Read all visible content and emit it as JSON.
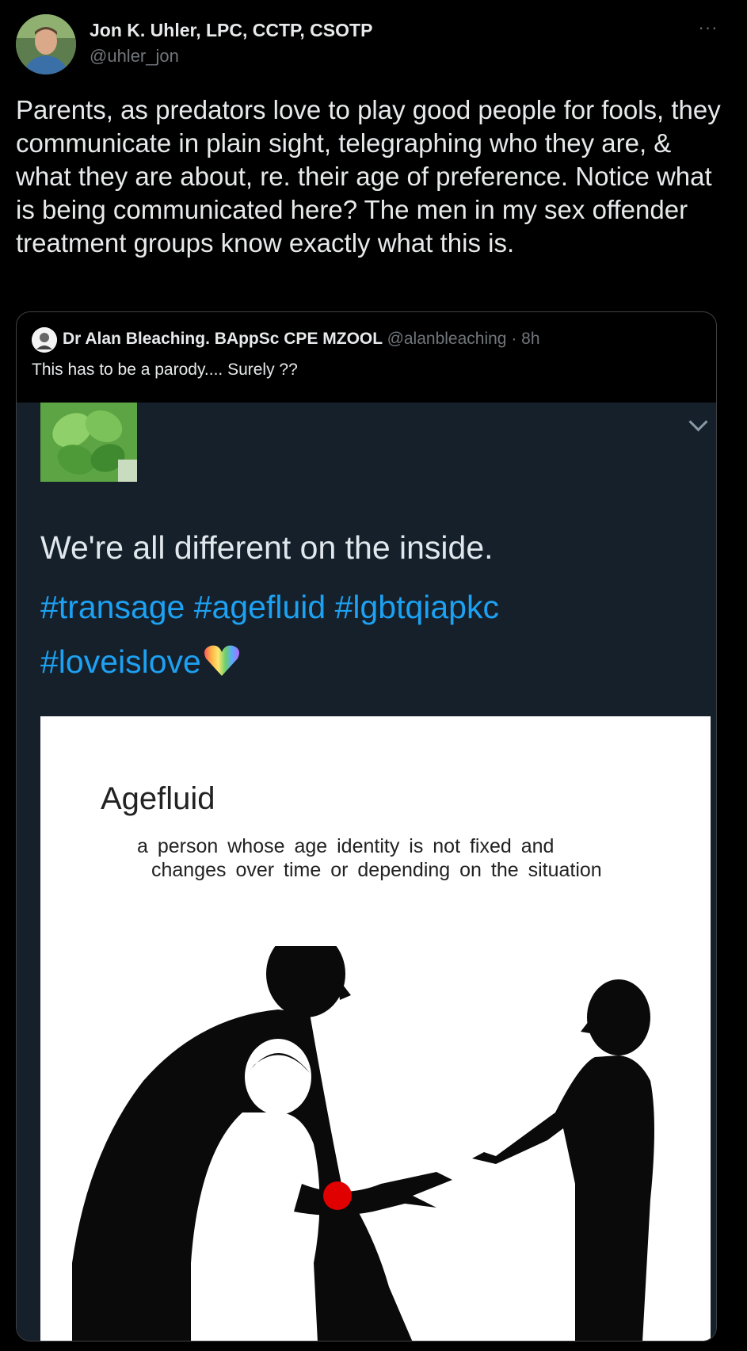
{
  "tweet": {
    "author_name": "Jon K. Uhler, LPC, CCTP, CSOTP",
    "author_handle": "@uhler_jon",
    "more_label": "···",
    "text": "Parents, as predators love to play good people for fools, they communicate in plain sight, telegraphing who they are, & what they are about, re. their age of preference. Notice what is being communicated here? The men in my sex offender treatment groups know exactly what this is."
  },
  "quoted": {
    "author_name": "Dr Alan Bleaching. BAppSc CPE MZOOL",
    "author_handle": "@alanbleaching",
    "time": "· 8h",
    "text": "This has to be a parody.... Surely ??",
    "image": {
      "caption": "We're all different on the inside.",
      "hashtags_line1": "#transage #agefluid #lgbtqiapkc",
      "hashtags_line2": "#loveislove",
      "definition_title": "Agefluid",
      "definition_line1": "a person whose age identity is not fixed and",
      "definition_line2": "changes over time or depending on the situation"
    }
  },
  "colors": {
    "background": "#000000",
    "text": "#e7e9ea",
    "muted": "#71767b",
    "link": "#1da1f2",
    "inner_bg": "#15202b"
  },
  "icons": [
    "more-icon",
    "chevron-down-icon",
    "rainbow-heart-icon"
  ]
}
